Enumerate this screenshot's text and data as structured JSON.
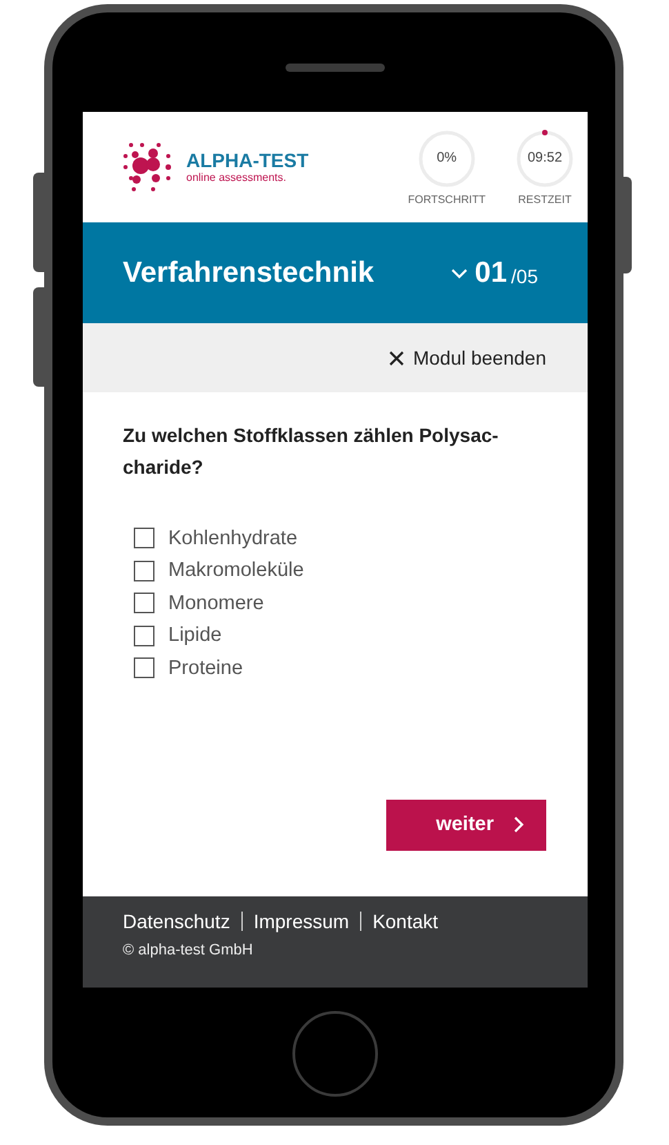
{
  "header": {
    "logo": {
      "name": "ALPHA-TEST",
      "tagline": "online assessments."
    },
    "progress": {
      "value": "0%",
      "label": "FORTSCHRITT"
    },
    "timer": {
      "value": "09:52",
      "label": "RESTZEIT"
    }
  },
  "module_bar": {
    "title": "Verfahrenstechnik",
    "current": "01",
    "total": "/05"
  },
  "exit_link": "Modul beenden",
  "question": "Zu welchen Stoffklassen zählen Polysac-charide?",
  "options": [
    {
      "label": "Kohlenhydrate",
      "checked": false
    },
    {
      "label": "Makromoleküle",
      "checked": false
    },
    {
      "label": "Monomere",
      "checked": false
    },
    {
      "label": "Lipide",
      "checked": false
    },
    {
      "label": "Proteine",
      "checked": false
    }
  ],
  "next_button": "weiter",
  "footer": {
    "links": [
      "Datenschutz",
      "Impressum",
      "Kontakt"
    ],
    "copyright": "© alpha-test GmbH"
  }
}
